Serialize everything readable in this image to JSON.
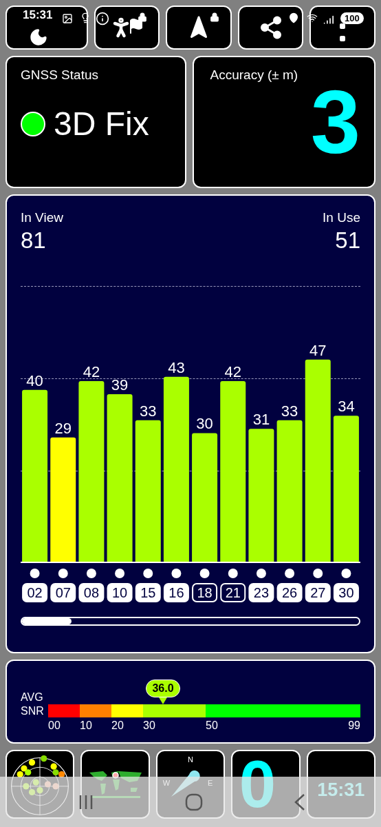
{
  "status_bar": {
    "time": "15:31",
    "battery": "100"
  },
  "top_tiles": [
    {
      "kind": "night",
      "locked": false
    },
    {
      "kind": "guide",
      "locked": true
    },
    {
      "kind": "navigate",
      "locked": true
    },
    {
      "kind": "share",
      "locked": false
    },
    {
      "kind": "menu",
      "locked": false
    }
  ],
  "gnss_status": {
    "title": "GNSS Status",
    "value": "3D Fix"
  },
  "accuracy": {
    "title": "Accuracy (± m)",
    "value": "3"
  },
  "signal_panel": {
    "in_view_label": "In View",
    "in_view": "81",
    "in_use_label": "In Use",
    "in_use": "51",
    "chart_data": {
      "type": "bar",
      "categories": [
        "02",
        "07",
        "08",
        "10",
        "15",
        "16",
        "18",
        "21",
        "23",
        "26",
        "27",
        "30"
      ],
      "values": [
        40,
        29,
        42,
        39,
        33,
        43,
        30,
        42,
        31,
        33,
        47,
        34
      ],
      "data_labels": true
    },
    "satellites": [
      {
        "used": true
      },
      {
        "used": true
      },
      {
        "used": true
      },
      {
        "used": true
      },
      {
        "used": true
      },
      {
        "used": true
      },
      {
        "used": false
      },
      {
        "used": false
      },
      {
        "used": true
      },
      {
        "used": true
      },
      {
        "used": true
      },
      {
        "used": true
      }
    ]
  },
  "snr": {
    "label_top": "AVG",
    "label_bottom": "SNR",
    "value": "36.0",
    "ticks": [
      "00",
      "10",
      "20",
      "30",
      "50",
      "99"
    ]
  },
  "bottom_tiles": {
    "compass": [
      "N",
      "W",
      "E"
    ],
    "count": "0",
    "clock": "15:31"
  }
}
